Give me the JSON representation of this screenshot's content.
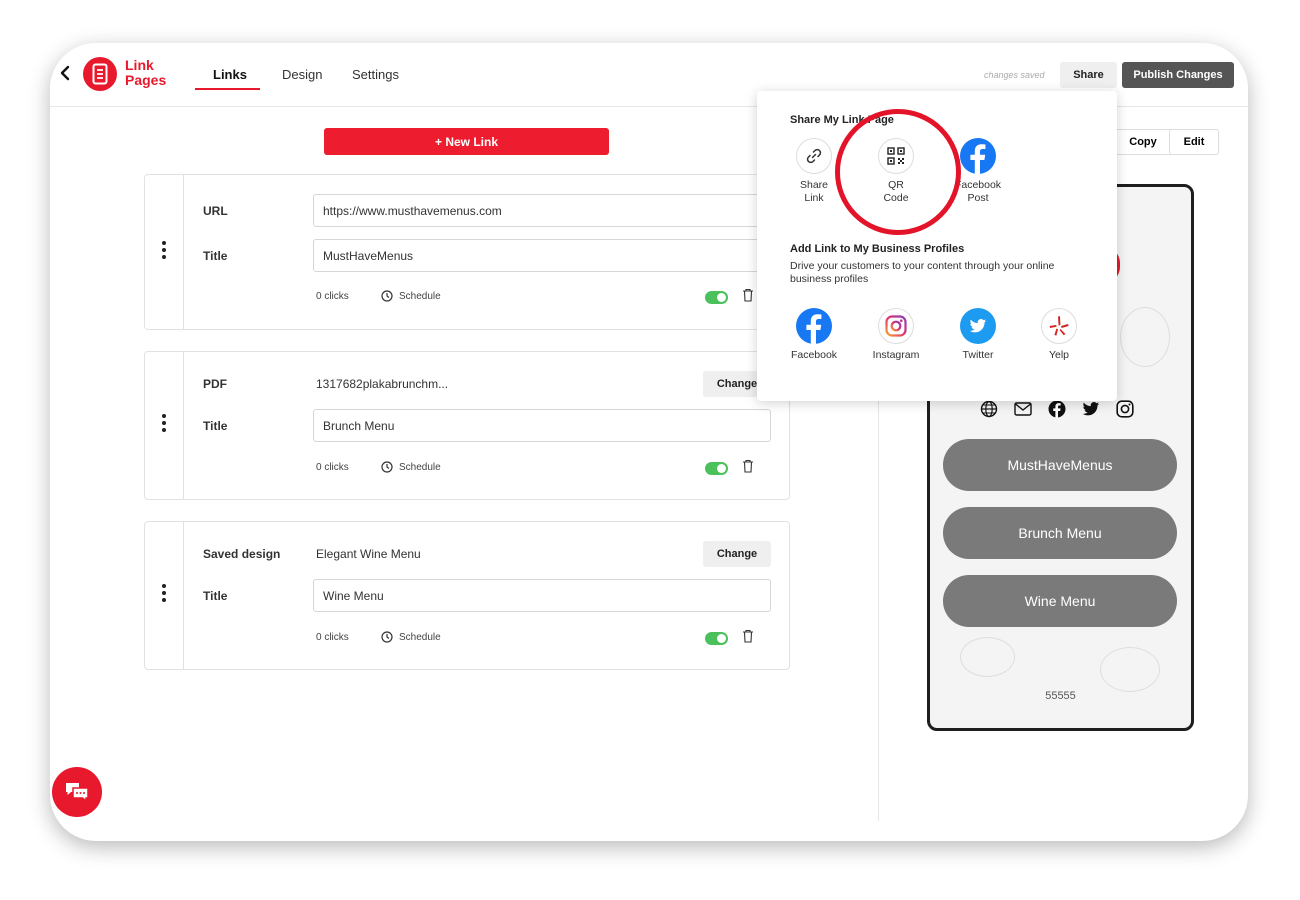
{
  "header": {
    "logo_text": "Link Pages",
    "tabs": [
      {
        "label": "Links",
        "active": true
      },
      {
        "label": "Design",
        "active": false
      },
      {
        "label": "Settings",
        "active": false
      }
    ],
    "save_status": "changes saved",
    "share_label": "Share",
    "publish_label": "Publish Changes"
  },
  "new_link_label": "+ New Link",
  "links": [
    {
      "type_label": "URL",
      "value": "https://www.musthavemenus.com",
      "title_label": "Title",
      "title": "MustHaveMenus",
      "clicks": "0 clicks",
      "schedule": "Schedule",
      "enabled": true
    },
    {
      "type_label": "PDF",
      "value": "1317682plakabrunchm...",
      "change_label": "Change",
      "title_label": "Title",
      "title": "Brunch Menu",
      "clicks": "0 clicks",
      "schedule": "Schedule",
      "enabled": true
    },
    {
      "type_label": "Saved design",
      "value": "Elegant Wine Menu",
      "change_label": "Change",
      "title_label": "Title",
      "title": "Wine Menu",
      "clicks": "0 clicks",
      "schedule": "Schedule",
      "enabled": true
    }
  ],
  "preview": {
    "copy_label": "Copy",
    "edit_label": "Edit",
    "social_icons": [
      "globe-icon",
      "mail-icon",
      "facebook-icon",
      "twitter-icon",
      "instagram-icon"
    ],
    "buttons": [
      "MustHaveMenus",
      "Brunch Menu",
      "Wine Menu"
    ],
    "footer": "55555"
  },
  "share_popover": {
    "share_title": "Share My Link Page",
    "share_options": [
      {
        "label_1": "Share",
        "label_2": "Link",
        "icon": "link-icon"
      },
      {
        "label_1": "QR",
        "label_2": "Code",
        "icon": "qr-code-icon"
      },
      {
        "label_1": "Facebook",
        "label_2": "Post",
        "icon": "facebook-icon"
      }
    ],
    "profiles_title": "Add Link to My Business Profiles",
    "profiles_desc": "Drive your customers to your content through your online business profiles",
    "profiles": [
      {
        "label": "Facebook",
        "icon": "facebook-icon"
      },
      {
        "label": "Instagram",
        "icon": "instagram-icon"
      },
      {
        "label": "Twitter",
        "icon": "twitter-icon"
      },
      {
        "label": "Yelp",
        "icon": "yelp-icon"
      }
    ]
  },
  "colors": {
    "brand_red": "#e8192c",
    "toggle_green": "#4bc15c",
    "facebook_blue": "#1877f2",
    "twitter_blue": "#1d9bf0",
    "preview_button_gray": "#7a7a7a"
  }
}
